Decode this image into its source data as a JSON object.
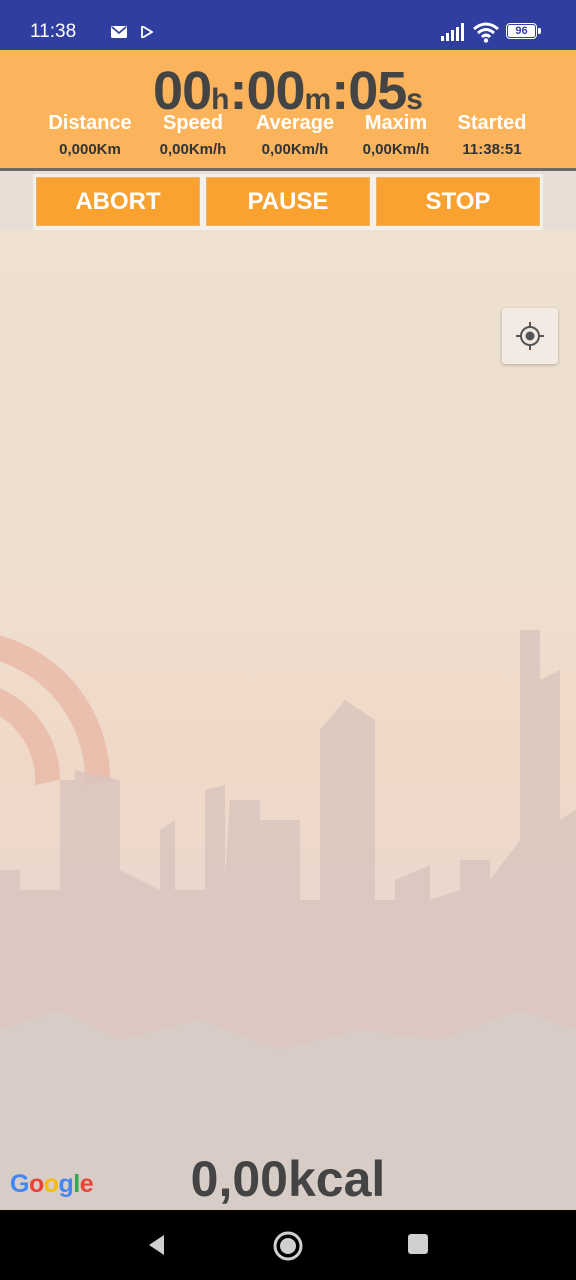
{
  "status_bar": {
    "time": "11:38",
    "battery": "96",
    "icons": [
      "mail-icon",
      "play-store-icon",
      "signal-icon",
      "wifi-icon",
      "battery-icon"
    ]
  },
  "timer": {
    "hours": "00",
    "hours_unit": "h",
    "minutes": "00",
    "minutes_unit": "m",
    "seconds": "05",
    "seconds_unit": "s",
    "sep": ":"
  },
  "stats": [
    {
      "label": "Distance",
      "value": "0,000Km"
    },
    {
      "label": "Speed",
      "value": "0,00Km/h"
    },
    {
      "label": "Average",
      "value": "0,00Km/h"
    },
    {
      "label": "Maxim",
      "value": "0,00Km/h"
    },
    {
      "label": "Started",
      "value": "11:38:51"
    }
  ],
  "buttons": {
    "abort": "ABORT",
    "pause": "PAUSE",
    "stop": "STOP"
  },
  "map": {
    "google_logo": {
      "G": "G",
      "o1": "o",
      "o2": "o",
      "g": "g",
      "l": "l",
      "e": "e"
    },
    "calories": "0,00kcal"
  },
  "colors": {
    "status_bar": "#303f9f",
    "header": "#fbb35c",
    "button": "#f9a230",
    "nav_bar": "#000000"
  }
}
